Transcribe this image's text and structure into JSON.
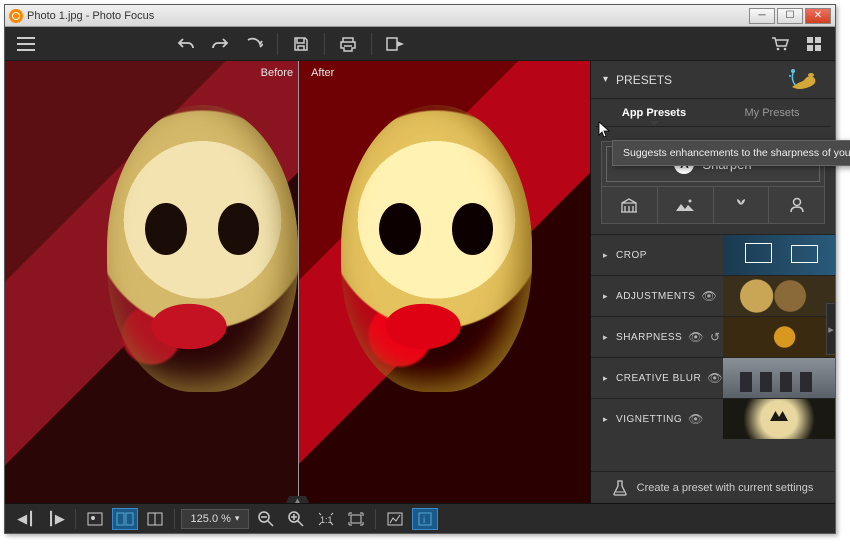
{
  "window": {
    "title": "Photo 1.jpg - Photo Focus"
  },
  "compare": {
    "before": "Before",
    "after": "After"
  },
  "panel": {
    "header": "PRESETS",
    "tabs": {
      "app": "App Presets",
      "my": "My Presets"
    },
    "sharpen_label": "Sharpen",
    "tooltip": "Suggests enhancements to the sharpness of your photos.",
    "sections": {
      "crop": "CROP",
      "adjustments": "ADJUSTMENTS",
      "sharpness": "SHARPNESS",
      "creative_blur": "CREATIVE BLUR",
      "vignetting": "VIGNETTING"
    },
    "footer": "Create a preset with current settings"
  },
  "bottombar": {
    "zoom_value": "125.0 %"
  },
  "icons": {
    "menu": "menu-icon",
    "undo": "undo-icon",
    "redo": "redo-icon",
    "redo2": "redo-forward-icon",
    "save": "save-icon",
    "print": "print-icon",
    "export": "export-icon",
    "cart": "cart-icon",
    "grid": "grid-icon",
    "arch": "architecture-icon",
    "landscape": "landscape-icon",
    "macro": "macro-icon",
    "portrait": "portrait-icon",
    "flask": "flask-icon",
    "eye": "eye-icon",
    "reset": "reset-icon"
  }
}
